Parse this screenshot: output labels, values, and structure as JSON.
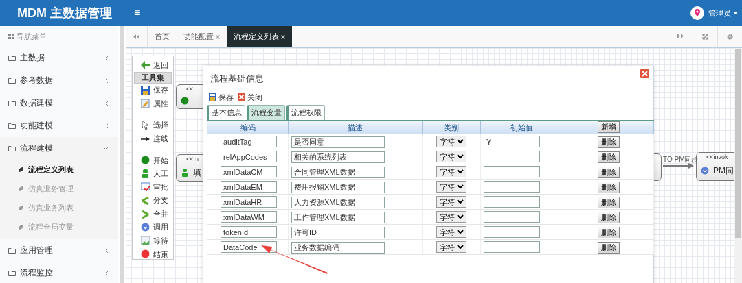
{
  "header": {
    "logo": "MDM 主数据管理",
    "menu_toggle": "≡",
    "user": "管理员"
  },
  "sidebar": {
    "title": "导航菜单",
    "items": [
      {
        "label": "主数据",
        "expanded": false
      },
      {
        "label": "参考数据",
        "expanded": false
      },
      {
        "label": "数据建模",
        "expanded": false
      },
      {
        "label": "功能建模",
        "expanded": false
      },
      {
        "label": "流程建模",
        "expanded": true,
        "children": [
          {
            "label": "流程定义列表",
            "selected": true
          },
          {
            "label": "仿真业务管理",
            "selected": false
          },
          {
            "label": "仿真业务列表",
            "selected": false
          },
          {
            "label": "流程全局变量",
            "selected": false
          }
        ]
      },
      {
        "label": "应用管理",
        "expanded": false
      },
      {
        "label": "流程监控",
        "expanded": false
      }
    ]
  },
  "tabs": [
    {
      "label": "首页",
      "closable": false,
      "selected": false
    },
    {
      "label": "功能配置",
      "closable": true,
      "selected": false
    },
    {
      "label": "流程定义列表",
      "closable": true,
      "selected": true
    }
  ],
  "palette": [
    {
      "label": "返回",
      "kind": "back"
    },
    {
      "label": "工具集",
      "kind": "heading"
    },
    {
      "label": "保存",
      "kind": "save"
    },
    {
      "label": "属性",
      "kind": "props"
    },
    {
      "kind": "divider"
    },
    {
      "label": "选择",
      "kind": "select"
    },
    {
      "label": "连线",
      "kind": "connect"
    },
    {
      "kind": "divider"
    },
    {
      "label": "开始",
      "kind": "start"
    },
    {
      "label": "人工",
      "kind": "human"
    },
    {
      "label": "审批",
      "kind": "approve"
    },
    {
      "label": "分支",
      "kind": "branch"
    },
    {
      "label": "合并",
      "kind": "merge"
    },
    {
      "label": "调用",
      "kind": "invoke"
    },
    {
      "label": "等待",
      "kind": "wait"
    },
    {
      "label": "结束",
      "kind": "end"
    }
  ],
  "diagram": {
    "nodes": [
      {
        "kind": "start",
        "stereotype": "<<"
      },
      {
        "kind": "human",
        "stereotype": "<<m",
        "label": "填"
      },
      {
        "kind": "task"
      },
      {
        "kind": "invoke",
        "stereotype": "<<invok",
        "label": "PM同"
      }
    ],
    "edge_label": "TO PM同步"
  },
  "dialog": {
    "title": "流程基础信息",
    "toolbar": [
      {
        "label": "保存",
        "kind": "save"
      },
      {
        "label": "关闭",
        "kind": "close"
      }
    ],
    "tabs": [
      {
        "label": "基本信息",
        "selected": false
      },
      {
        "label": "流程变量",
        "selected": true
      },
      {
        "label": "流程权限",
        "selected": false
      }
    ],
    "columns": [
      "编码",
      "描述",
      "类别",
      "初始值"
    ],
    "add_button": "新增",
    "rows": [
      {
        "code": "auditTag",
        "description": "是否同意",
        "type": "字符",
        "initial": "Y",
        "delete": "删除"
      },
      {
        "code": "relAppCodes",
        "description": "相关的系统列表",
        "type": "字符",
        "delete": "删除"
      },
      {
        "code": "xmlDataCM",
        "description": "合同管理XML数据",
        "type": "字符",
        "delete": "删除"
      },
      {
        "code": "xmlDataEM",
        "description": "费用报销XML数据",
        "type": "字符",
        "delete": "删除"
      },
      {
        "code": "xmlDataHR",
        "description": "人力资源XML数据",
        "type": "字符",
        "delete": "删除"
      },
      {
        "code": "xmlDataWM",
        "description": "工作管理XML数据",
        "type": "字符",
        "delete": "删除"
      },
      {
        "code": "tokenId",
        "description": "许可ID",
        "type": "字符",
        "delete": "删除"
      },
      {
        "code": "DataCode",
        "description": "业务数据编码",
        "type": "字符",
        "delete": "删除"
      }
    ]
  }
}
